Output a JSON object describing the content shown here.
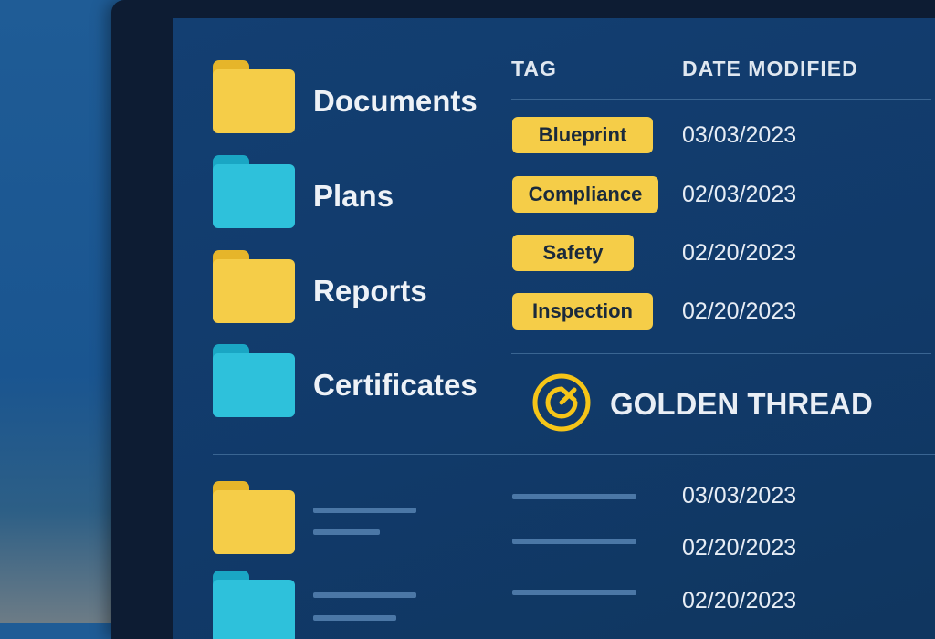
{
  "folders": [
    {
      "label": "Documents",
      "color": "yellow"
    },
    {
      "label": "Plans",
      "color": "cyan"
    },
    {
      "label": "Reports",
      "color": "yellow"
    },
    {
      "label": "Certificates",
      "color": "cyan"
    }
  ],
  "table": {
    "headers": {
      "tag": "TAG",
      "date": "DATE MODIFIED"
    },
    "rows": [
      {
        "tag": "Blueprint",
        "date": "03/03/2023"
      },
      {
        "tag": "Compliance",
        "date": "02/03/2023"
      },
      {
        "tag": "Safety",
        "date": "02/20/2023"
      },
      {
        "tag": "Inspection",
        "date": "02/20/2023"
      }
    ]
  },
  "brand": {
    "name": "GOLDEN THREAD",
    "icon": "golden-thread-logo-icon"
  },
  "lower_list": {
    "dates": [
      "03/03/2023",
      "02/20/2023",
      "02/20/2023"
    ]
  },
  "colors": {
    "accent_yellow": "#f5cd48",
    "accent_cyan": "#2ec1db",
    "screen_bg": "#123c6d"
  }
}
